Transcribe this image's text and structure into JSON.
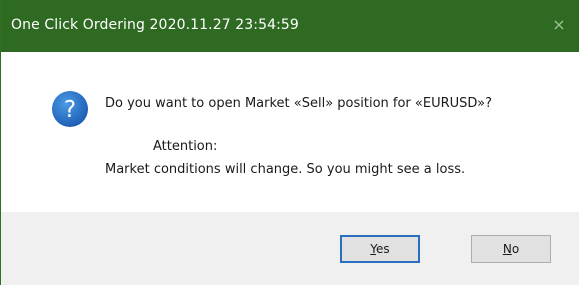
{
  "window": {
    "title": "One Click Ordering 2020.11.27 23:54:59",
    "close_glyph": "×",
    "titlebar_color": "#2f6a23",
    "close_icon": "close-icon"
  },
  "message": {
    "icon": "question-icon",
    "icon_color": "#1f6fc5",
    "question": "Do you want to open Market «Sell» position for «EURUSD»?",
    "attention": "Attention:",
    "warning": "Market conditions will change. So you might see a loss."
  },
  "buttons": {
    "yes_hotkey": "Y",
    "yes_rest": "es",
    "no_hotkey": "N",
    "no_rest": "o"
  }
}
